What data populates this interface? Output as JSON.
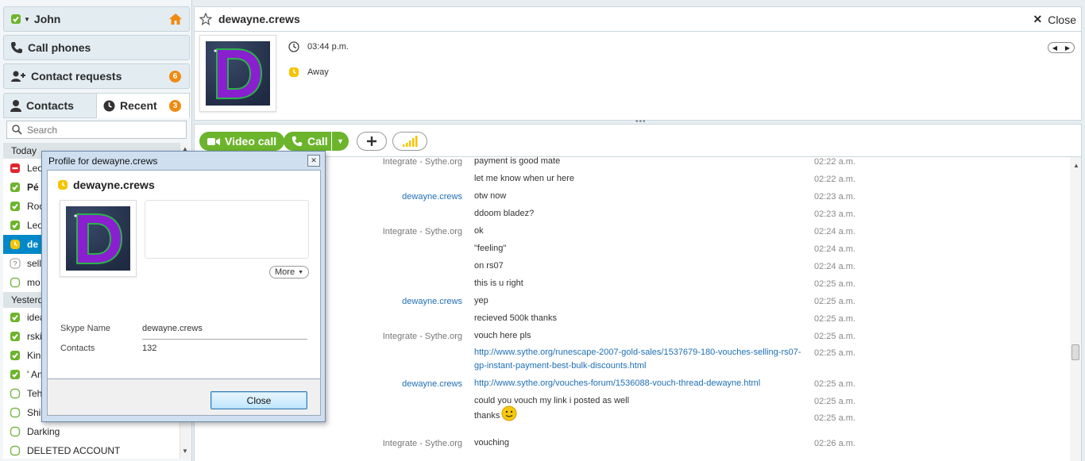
{
  "sidebar": {
    "user_name": "John",
    "call_phones": "Call phones",
    "contact_requests": {
      "label": "Contact requests",
      "count": "6"
    },
    "tabs": [
      {
        "label": "Contacts"
      },
      {
        "label": "Recent",
        "count": "3"
      }
    ],
    "search_placeholder": "Search",
    "groups": [
      {
        "label": "Today",
        "items": [
          {
            "name": "Leo",
            "status": "busy"
          },
          {
            "name": "Pé",
            "status": "online",
            "bold": true
          },
          {
            "name": "Roo",
            "status": "online"
          },
          {
            "name": "Leo",
            "status": "online"
          },
          {
            "name": "de",
            "status": "away",
            "selected": true
          },
          {
            "name": "sell",
            "status": "unknown"
          },
          {
            "name": "mo",
            "status": "offline"
          }
        ]
      },
      {
        "label": "Yesterd",
        "items": [
          {
            "name": "idea",
            "status": "online"
          },
          {
            "name": "rski",
            "status": "online"
          },
          {
            "name": "King",
            "status": "online"
          },
          {
            "name": "' An",
            "status": "online"
          },
          {
            "name": "Teh",
            "status": "offline"
          },
          {
            "name": "Ship",
            "status": "offline"
          },
          {
            "name": "Darking",
            "status": "offline"
          },
          {
            "name": "DELETED ACCOUNT",
            "status": "offline"
          }
        ]
      }
    ]
  },
  "conversation": {
    "contact_name": "dewayne.crews",
    "close_label": "Close",
    "local_time": "03:44 p.m.",
    "status": "Away",
    "buttons": {
      "video_call": "Video call",
      "call": "Call"
    },
    "messages": [
      {
        "sender": "Integrate - Sythe.org",
        "them": false,
        "text": "payment is good mate",
        "time": "02:22 a.m."
      },
      {
        "sender": "",
        "them": false,
        "text": "let me know when ur here",
        "time": "02:22 a.m."
      },
      {
        "sender": "dewayne.crews",
        "them": true,
        "text": "otw now",
        "time": "02:23 a.m."
      },
      {
        "sender": "",
        "them": true,
        "text": "ddoom bladez?",
        "time": "02:23 a.m."
      },
      {
        "sender": "Integrate - Sythe.org",
        "them": false,
        "text": "ok",
        "time": "02:24 a.m."
      },
      {
        "sender": "",
        "them": false,
        "text": "\"feeling\"",
        "time": "02:24 a.m."
      },
      {
        "sender": "",
        "them": false,
        "text": "on rs07",
        "time": "02:24 a.m."
      },
      {
        "sender": "",
        "them": false,
        "text": "this is u right",
        "time": "02:25 a.m."
      },
      {
        "sender": "dewayne.crews",
        "them": true,
        "text": "yep",
        "time": "02:25 a.m."
      },
      {
        "sender": "",
        "them": true,
        "text": "recieved 500k thanks",
        "time": "02:25 a.m."
      },
      {
        "sender": "Integrate - Sythe.org",
        "them": false,
        "text": "vouch here pls",
        "time": "02:25 a.m."
      },
      {
        "sender": "",
        "them": false,
        "text": "http://www.sythe.org/runescape-2007-gold-sales/1537679-180-vouches-selling-rs07-gp-instant-payment-best-bulk-discounts.html",
        "time": "02:25 a.m.",
        "link": true
      },
      {
        "sender": "dewayne.crews",
        "them": true,
        "text": "http://www.sythe.org/vouches-forum/1536088-vouch-thread-dewayne.html",
        "time": "02:25 a.m.",
        "link": true
      },
      {
        "sender": "",
        "them": true,
        "text": "could you vouch my link i posted as well",
        "time": "02:25 a.m."
      },
      {
        "sender": "",
        "them": true,
        "text": "thanks",
        "time": "02:25 a.m.",
        "emoticon": true
      },
      {
        "sender": "Integrate - Sythe.org",
        "them": false,
        "text": "vouching",
        "time": "02:26 a.m."
      }
    ]
  },
  "dialog": {
    "title": "Profile for dewayne.crews",
    "name": "dewayne.crews",
    "more_label": "More",
    "fields": [
      {
        "key": "Skype Name",
        "value": "dewayne.crews"
      },
      {
        "key": "Contacts",
        "value": "132"
      }
    ],
    "close_label": "Close"
  },
  "colors": {
    "skype_green": "#6cb42c",
    "selection_blue": "#0088c8",
    "away_yellow": "#f5c400",
    "badge_orange": "#f08a10",
    "link_blue": "#1f6fb5",
    "avatar_purple": "#8a1fd0"
  },
  "icons": [
    "home-icon",
    "phone-icon",
    "add-contact-icon",
    "person-icon",
    "clock-icon",
    "search-icon",
    "star-icon",
    "close-icon",
    "globe-clock-icon",
    "away-status-icon",
    "video-icon",
    "plus-icon",
    "signal-icon"
  ]
}
